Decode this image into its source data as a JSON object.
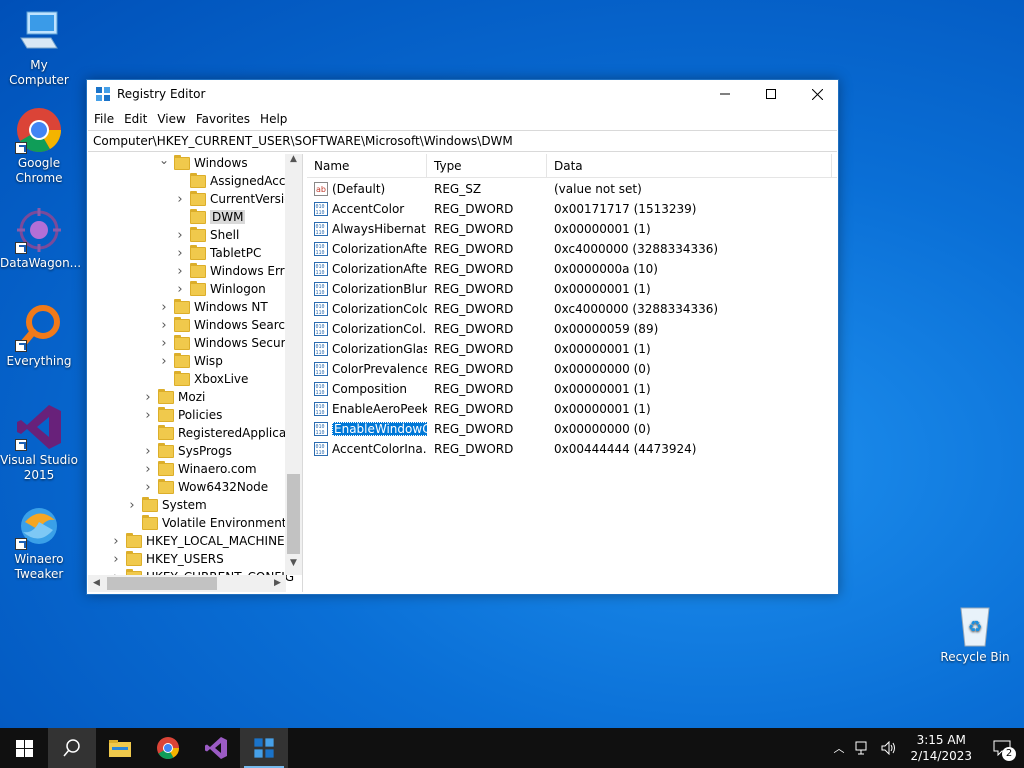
{
  "desktop": {
    "icons": [
      {
        "label": "My Computer"
      },
      {
        "label": "Google Chrome"
      },
      {
        "label": "DataWagon..."
      },
      {
        "label": "Everything"
      },
      {
        "label": "Visual Studio 2015"
      },
      {
        "label": "Winaero Tweaker"
      },
      {
        "label": "Recycle Bin"
      }
    ]
  },
  "window": {
    "title": "Registry Editor",
    "menu": [
      "File",
      "Edit",
      "View",
      "Favorites",
      "Help"
    ],
    "address": "Computer\\HKEY_CURRENT_USER\\SOFTWARE\\Microsoft\\Windows\\DWM"
  },
  "tree": {
    "items": [
      {
        "label": "Windows",
        "state": "expanded"
      },
      {
        "label": "AssignedAcce",
        "state": "none"
      },
      {
        "label": "CurrentVersion",
        "state": "collapsed"
      },
      {
        "label": "DWM",
        "state": "none",
        "selected": true
      },
      {
        "label": "Shell",
        "state": "collapsed"
      },
      {
        "label": "TabletPC",
        "state": "collapsed"
      },
      {
        "label": "Windows Error",
        "state": "collapsed"
      },
      {
        "label": "Winlogon",
        "state": "collapsed"
      },
      {
        "label": "Windows NT",
        "state": "collapsed"
      },
      {
        "label": "Windows Search",
        "state": "collapsed"
      },
      {
        "label": "Windows Security",
        "state": "collapsed"
      },
      {
        "label": "Wisp",
        "state": "collapsed"
      },
      {
        "label": "XboxLive",
        "state": "none"
      },
      {
        "label": "Mozi",
        "state": "collapsed"
      },
      {
        "label": "Policies",
        "state": "collapsed"
      },
      {
        "label": "RegisteredApplicatic",
        "state": "none"
      },
      {
        "label": "SysProgs",
        "state": "collapsed"
      },
      {
        "label": "Winaero.com",
        "state": "collapsed"
      },
      {
        "label": "Wow6432Node",
        "state": "collapsed"
      },
      {
        "label": "System",
        "state": "collapsed"
      },
      {
        "label": "Volatile Environment",
        "state": "none"
      },
      {
        "label": "HKEY_LOCAL_MACHINE",
        "state": "collapsed"
      },
      {
        "label": "HKEY_USERS",
        "state": "collapsed"
      },
      {
        "label": "HKEY_CURRENT_CONFIG",
        "state": "collapsed"
      }
    ]
  },
  "list": {
    "headers": [
      "Name",
      "Type",
      "Data"
    ],
    "rows": [
      {
        "name": "(Default)",
        "type": "REG_SZ",
        "data": "(value not set)",
        "icon": "string-value-icon"
      },
      {
        "name": "AccentColor",
        "type": "REG_DWORD",
        "data": "0x00171717 (1513239)",
        "icon": "binary-value-icon"
      },
      {
        "name": "AlwaysHibernat...",
        "type": "REG_DWORD",
        "data": "0x00000001 (1)",
        "icon": "binary-value-icon"
      },
      {
        "name": "ColorizationAfte...",
        "type": "REG_DWORD",
        "data": "0xc4000000 (3288334336)",
        "icon": "binary-value-icon"
      },
      {
        "name": "ColorizationAfte...",
        "type": "REG_DWORD",
        "data": "0x0000000a (10)",
        "icon": "binary-value-icon"
      },
      {
        "name": "ColorizationBlur...",
        "type": "REG_DWORD",
        "data": "0x00000001 (1)",
        "icon": "binary-value-icon"
      },
      {
        "name": "ColorizationColor",
        "type": "REG_DWORD",
        "data": "0xc4000000 (3288334336)",
        "icon": "binary-value-icon"
      },
      {
        "name": "ColorizationCol...",
        "type": "REG_DWORD",
        "data": "0x00000059 (89)",
        "icon": "binary-value-icon"
      },
      {
        "name": "ColorizationGlas...",
        "type": "REG_DWORD",
        "data": "0x00000001 (1)",
        "icon": "binary-value-icon"
      },
      {
        "name": "ColorPrevalence",
        "type": "REG_DWORD",
        "data": "0x00000000 (0)",
        "icon": "binary-value-icon"
      },
      {
        "name": "Composition",
        "type": "REG_DWORD",
        "data": "0x00000001 (1)",
        "icon": "binary-value-icon"
      },
      {
        "name": "EnableAeroPeek",
        "type": "REG_DWORD",
        "data": "0x00000001 (1)",
        "icon": "binary-value-icon"
      },
      {
        "name": "EnableWindowC...",
        "type": "REG_DWORD",
        "data": "0x00000000 (0)",
        "icon": "binary-value-icon",
        "selected": true
      },
      {
        "name": "AccentColorIna...",
        "type": "REG_DWORD",
        "data": "0x00444444 (4473924)",
        "icon": "binary-value-icon"
      }
    ]
  },
  "taskbar": {
    "time": "3:15 AM",
    "date": "2/14/2023",
    "notification_count": "2"
  },
  "colors": {
    "accent": "#0078d7",
    "desktop": "#0a6fd6",
    "taskbar": "#101010"
  }
}
